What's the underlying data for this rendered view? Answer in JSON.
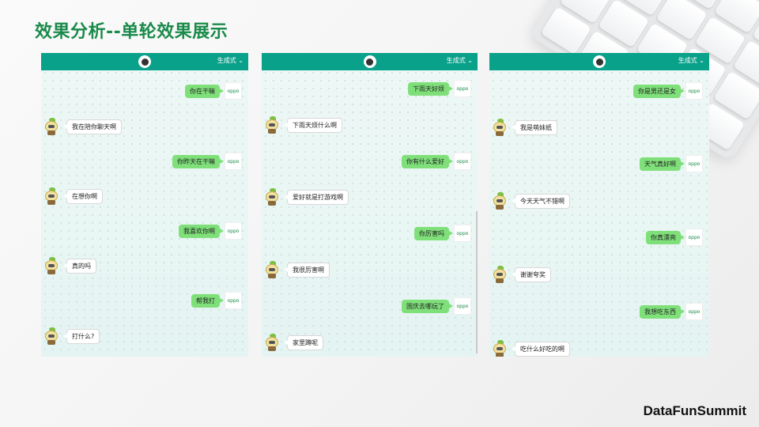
{
  "slide": {
    "title": "效果分析--单轮效果展示",
    "brand": "DataFunSummit"
  },
  "panels": [
    {
      "header": {
        "mode_label": "生成式",
        "chevron": "chevron-down-icon"
      },
      "messages": [
        {
          "from": "user",
          "text": "你在干嘛"
        },
        {
          "from": "bot",
          "text": "我在陪你聊天啊"
        },
        {
          "from": "user",
          "text": "你昨天在干嘛"
        },
        {
          "from": "bot",
          "text": "在想你啊"
        },
        {
          "from": "user",
          "text": "我喜欢你啊"
        },
        {
          "from": "bot",
          "text": "真的吗"
        },
        {
          "from": "user",
          "text": "帮我打"
        },
        {
          "from": "bot",
          "text": "打什么?"
        }
      ]
    },
    {
      "header": {
        "mode_label": "生成式",
        "chevron": "chevron-down-icon"
      },
      "messages": [
        {
          "from": "user",
          "text": "下雨天好烦"
        },
        {
          "from": "bot",
          "text": "下雨天烦什么啊"
        },
        {
          "from": "user",
          "text": "你有什么爱好"
        },
        {
          "from": "bot",
          "text": "爱好就是打游戏啊"
        },
        {
          "from": "user",
          "text": "你厉害吗"
        },
        {
          "from": "bot",
          "text": "我很厉害啊"
        },
        {
          "from": "user",
          "text": "国庆去哪玩了"
        },
        {
          "from": "bot",
          "text": "家里蹲呢"
        }
      ]
    },
    {
      "header": {
        "mode_label": "生成式",
        "chevron": "chevron-down-icon"
      },
      "messages": [
        {
          "from": "user",
          "text": "你是男还是女"
        },
        {
          "from": "bot",
          "text": "我是萌妹纸"
        },
        {
          "from": "user",
          "text": "天气真好啊"
        },
        {
          "from": "bot",
          "text": "今天天气不错啊"
        },
        {
          "from": "user",
          "text": "你真漂亮"
        },
        {
          "from": "bot",
          "text": "谢谢夸奖"
        },
        {
          "from": "user",
          "text": "我想吃东西"
        },
        {
          "from": "bot",
          "text": "吃什么好吃的啊"
        }
      ]
    }
  ],
  "user_avatar_text": "oppo",
  "colors": {
    "title": "#1a8a4a",
    "header": "#0aa18a",
    "user_bubble": "#7fe07a",
    "bot_bubble": "#ffffff"
  }
}
